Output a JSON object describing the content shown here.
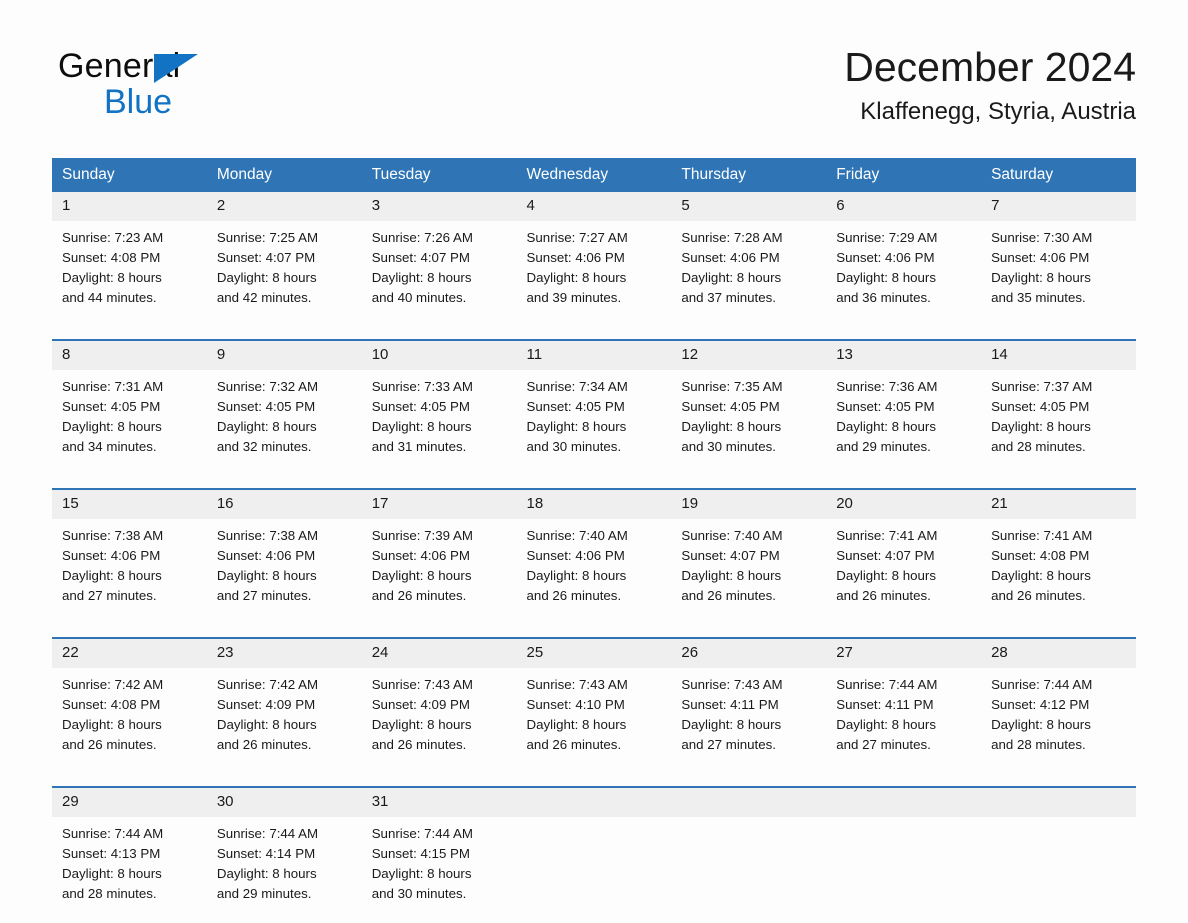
{
  "brand": {
    "line1": "General",
    "line2": "Blue",
    "triangle_icon": "brand-triangle-icon",
    "accent_color": "#1273c4"
  },
  "header": {
    "title": "December 2024",
    "subtitle": "Klaffenegg, Styria, Austria"
  },
  "colors": {
    "header_blue": "#2f75b5",
    "daynum_gray": "#efefef",
    "page_background": "#fdfdfd"
  },
  "weekday_headers": [
    "Sunday",
    "Monday",
    "Tuesday",
    "Wednesday",
    "Thursday",
    "Friday",
    "Saturday"
  ],
  "weeks": [
    [
      {
        "day": "1",
        "sunrise": "Sunrise: 7:23 AM",
        "sunset": "Sunset: 4:08 PM",
        "daylight_line1": "Daylight: 8 hours",
        "daylight_line2": "and 44 minutes."
      },
      {
        "day": "2",
        "sunrise": "Sunrise: 7:25 AM",
        "sunset": "Sunset: 4:07 PM",
        "daylight_line1": "Daylight: 8 hours",
        "daylight_line2": "and 42 minutes."
      },
      {
        "day": "3",
        "sunrise": "Sunrise: 7:26 AM",
        "sunset": "Sunset: 4:07 PM",
        "daylight_line1": "Daylight: 8 hours",
        "daylight_line2": "and 40 minutes."
      },
      {
        "day": "4",
        "sunrise": "Sunrise: 7:27 AM",
        "sunset": "Sunset: 4:06 PM",
        "daylight_line1": "Daylight: 8 hours",
        "daylight_line2": "and 39 minutes."
      },
      {
        "day": "5",
        "sunrise": "Sunrise: 7:28 AM",
        "sunset": "Sunset: 4:06 PM",
        "daylight_line1": "Daylight: 8 hours",
        "daylight_line2": "and 37 minutes."
      },
      {
        "day": "6",
        "sunrise": "Sunrise: 7:29 AM",
        "sunset": "Sunset: 4:06 PM",
        "daylight_line1": "Daylight: 8 hours",
        "daylight_line2": "and 36 minutes."
      },
      {
        "day": "7",
        "sunrise": "Sunrise: 7:30 AM",
        "sunset": "Sunset: 4:06 PM",
        "daylight_line1": "Daylight: 8 hours",
        "daylight_line2": "and 35 minutes."
      }
    ],
    [
      {
        "day": "8",
        "sunrise": "Sunrise: 7:31 AM",
        "sunset": "Sunset: 4:05 PM",
        "daylight_line1": "Daylight: 8 hours",
        "daylight_line2": "and 34 minutes."
      },
      {
        "day": "9",
        "sunrise": "Sunrise: 7:32 AM",
        "sunset": "Sunset: 4:05 PM",
        "daylight_line1": "Daylight: 8 hours",
        "daylight_line2": "and 32 minutes."
      },
      {
        "day": "10",
        "sunrise": "Sunrise: 7:33 AM",
        "sunset": "Sunset: 4:05 PM",
        "daylight_line1": "Daylight: 8 hours",
        "daylight_line2": "and 31 minutes."
      },
      {
        "day": "11",
        "sunrise": "Sunrise: 7:34 AM",
        "sunset": "Sunset: 4:05 PM",
        "daylight_line1": "Daylight: 8 hours",
        "daylight_line2": "and 30 minutes."
      },
      {
        "day": "12",
        "sunrise": "Sunrise: 7:35 AM",
        "sunset": "Sunset: 4:05 PM",
        "daylight_line1": "Daylight: 8 hours",
        "daylight_line2": "and 30 minutes."
      },
      {
        "day": "13",
        "sunrise": "Sunrise: 7:36 AM",
        "sunset": "Sunset: 4:05 PM",
        "daylight_line1": "Daylight: 8 hours",
        "daylight_line2": "and 29 minutes."
      },
      {
        "day": "14",
        "sunrise": "Sunrise: 7:37 AM",
        "sunset": "Sunset: 4:05 PM",
        "daylight_line1": "Daylight: 8 hours",
        "daylight_line2": "and 28 minutes."
      }
    ],
    [
      {
        "day": "15",
        "sunrise": "Sunrise: 7:38 AM",
        "sunset": "Sunset: 4:06 PM",
        "daylight_line1": "Daylight: 8 hours",
        "daylight_line2": "and 27 minutes."
      },
      {
        "day": "16",
        "sunrise": "Sunrise: 7:38 AM",
        "sunset": "Sunset: 4:06 PM",
        "daylight_line1": "Daylight: 8 hours",
        "daylight_line2": "and 27 minutes."
      },
      {
        "day": "17",
        "sunrise": "Sunrise: 7:39 AM",
        "sunset": "Sunset: 4:06 PM",
        "daylight_line1": "Daylight: 8 hours",
        "daylight_line2": "and 26 minutes."
      },
      {
        "day": "18",
        "sunrise": "Sunrise: 7:40 AM",
        "sunset": "Sunset: 4:06 PM",
        "daylight_line1": "Daylight: 8 hours",
        "daylight_line2": "and 26 minutes."
      },
      {
        "day": "19",
        "sunrise": "Sunrise: 7:40 AM",
        "sunset": "Sunset: 4:07 PM",
        "daylight_line1": "Daylight: 8 hours",
        "daylight_line2": "and 26 minutes."
      },
      {
        "day": "20",
        "sunrise": "Sunrise: 7:41 AM",
        "sunset": "Sunset: 4:07 PM",
        "daylight_line1": "Daylight: 8 hours",
        "daylight_line2": "and 26 minutes."
      },
      {
        "day": "21",
        "sunrise": "Sunrise: 7:41 AM",
        "sunset": "Sunset: 4:08 PM",
        "daylight_line1": "Daylight: 8 hours",
        "daylight_line2": "and 26 minutes."
      }
    ],
    [
      {
        "day": "22",
        "sunrise": "Sunrise: 7:42 AM",
        "sunset": "Sunset: 4:08 PM",
        "daylight_line1": "Daylight: 8 hours",
        "daylight_line2": "and 26 minutes."
      },
      {
        "day": "23",
        "sunrise": "Sunrise: 7:42 AM",
        "sunset": "Sunset: 4:09 PM",
        "daylight_line1": "Daylight: 8 hours",
        "daylight_line2": "and 26 minutes."
      },
      {
        "day": "24",
        "sunrise": "Sunrise: 7:43 AM",
        "sunset": "Sunset: 4:09 PM",
        "daylight_line1": "Daylight: 8 hours",
        "daylight_line2": "and 26 minutes."
      },
      {
        "day": "25",
        "sunrise": "Sunrise: 7:43 AM",
        "sunset": "Sunset: 4:10 PM",
        "daylight_line1": "Daylight: 8 hours",
        "daylight_line2": "and 26 minutes."
      },
      {
        "day": "26",
        "sunrise": "Sunrise: 7:43 AM",
        "sunset": "Sunset: 4:11 PM",
        "daylight_line1": "Daylight: 8 hours",
        "daylight_line2": "and 27 minutes."
      },
      {
        "day": "27",
        "sunrise": "Sunrise: 7:44 AM",
        "sunset": "Sunset: 4:11 PM",
        "daylight_line1": "Daylight: 8 hours",
        "daylight_line2": "and 27 minutes."
      },
      {
        "day": "28",
        "sunrise": "Sunrise: 7:44 AM",
        "sunset": "Sunset: 4:12 PM",
        "daylight_line1": "Daylight: 8 hours",
        "daylight_line2": "and 28 minutes."
      }
    ],
    [
      {
        "day": "29",
        "sunrise": "Sunrise: 7:44 AM",
        "sunset": "Sunset: 4:13 PM",
        "daylight_line1": "Daylight: 8 hours",
        "daylight_line2": "and 28 minutes."
      },
      {
        "day": "30",
        "sunrise": "Sunrise: 7:44 AM",
        "sunset": "Sunset: 4:14 PM",
        "daylight_line1": "Daylight: 8 hours",
        "daylight_line2": "and 29 minutes."
      },
      {
        "day": "31",
        "sunrise": "Sunrise: 7:44 AM",
        "sunset": "Sunset: 4:15 PM",
        "daylight_line1": "Daylight: 8 hours",
        "daylight_line2": "and 30 minutes."
      },
      {
        "day": "",
        "sunrise": "",
        "sunset": "",
        "daylight_line1": "",
        "daylight_line2": ""
      },
      {
        "day": "",
        "sunrise": "",
        "sunset": "",
        "daylight_line1": "",
        "daylight_line2": ""
      },
      {
        "day": "",
        "sunrise": "",
        "sunset": "",
        "daylight_line1": "",
        "daylight_line2": ""
      },
      {
        "day": "",
        "sunrise": "",
        "sunset": "",
        "daylight_line1": "",
        "daylight_line2": ""
      }
    ]
  ]
}
